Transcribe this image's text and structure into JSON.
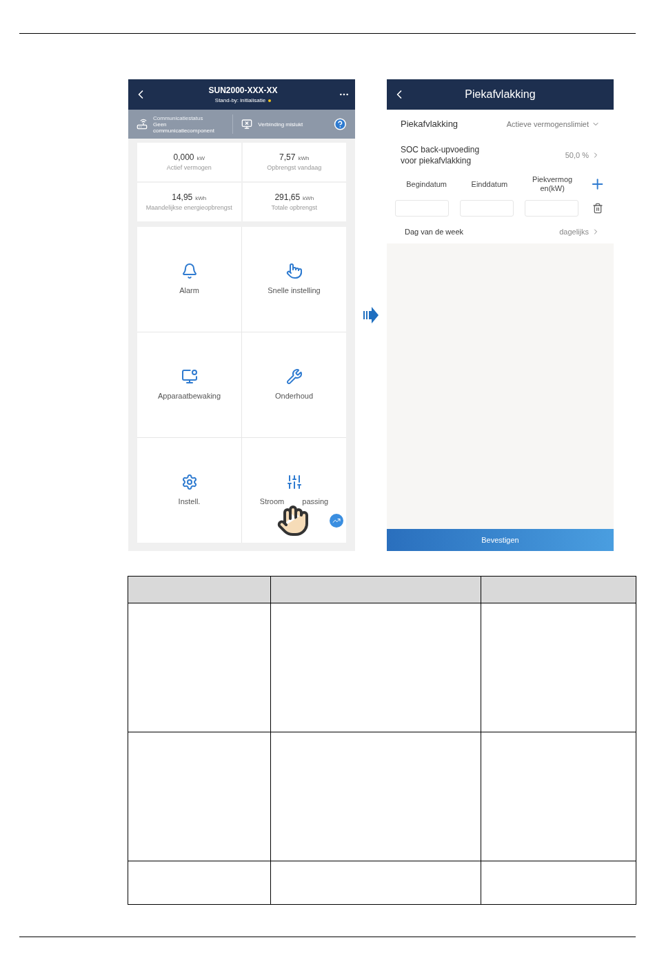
{
  "left_screen": {
    "title": "SUN2000-XXX-XX",
    "subtitle": "Stand-by: initialisatie",
    "status": [
      {
        "caption": "Communicatiestatus",
        "value": "Geen communicatiecomponent",
        "kind": "comm"
      },
      {
        "value": "Verbinding mislukt",
        "kind": "alarm"
      }
    ],
    "stats": [
      {
        "value": "0,000",
        "unit": "kW",
        "label": "Actief vermogen"
      },
      {
        "value": "7,57",
        "unit": "kWh",
        "label": "Opbrengst vandaag"
      },
      {
        "value": "14,95",
        "unit": "kWh",
        "label": "Maandelijkse energieopbrengst"
      },
      {
        "value": "291,65",
        "unit": "kWh",
        "label": "Totale opbrengst"
      }
    ],
    "tiles": [
      {
        "label": "Alarm",
        "kind": "alarm"
      },
      {
        "label": "Snelle instelling",
        "kind": "quick"
      },
      {
        "label": "Apparaatbewaking",
        "kind": "monitor"
      },
      {
        "label": "Onderhoud",
        "kind": "maintenance"
      },
      {
        "label": "Instell.",
        "kind": "settings"
      },
      {
        "label": "Stroom",
        "label_end": "passing",
        "kind": "power"
      }
    ]
  },
  "right_screen": {
    "title": "Piekafvlakking",
    "mode": {
      "label": "Piekafvlakking",
      "value": "Actieve vermogenslimiet"
    },
    "soc": {
      "label": "SOC back-upvoeding voor piekafvlakking",
      "value": "50,0 %"
    },
    "columns": [
      "Begindatum",
      "Einddatum",
      "Piekvermog en(kW)"
    ],
    "weekday": {
      "label": "Dag van de week",
      "value": "dagelijks"
    },
    "confirm": "Bevestigen"
  }
}
